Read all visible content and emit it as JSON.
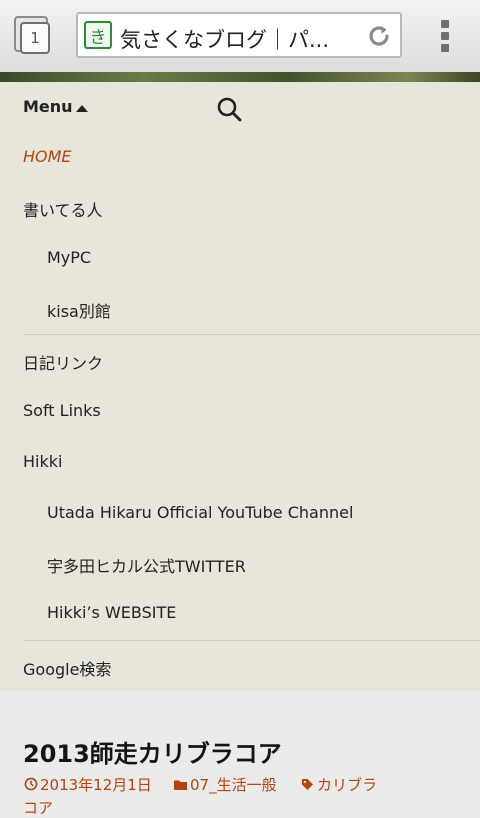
{
  "browser": {
    "tab_count": "1",
    "favicon_char": "き",
    "page_title": "気さくなブログ｜パ..."
  },
  "menu": {
    "label": "Menu",
    "items": [
      {
        "label": "HOME"
      },
      {
        "label": "書いてる人"
      },
      {
        "label": "MyPC"
      },
      {
        "label": "kisa別館"
      },
      {
        "label": "日記リンク"
      },
      {
        "label": "Soft Links"
      },
      {
        "label": "Hikki"
      },
      {
        "label": "Utada Hikaru Official YouTube Channel"
      },
      {
        "label": "宇多田ヒカル公式TWITTER"
      },
      {
        "label": "Hikki’s WEBSITE"
      },
      {
        "label": "Google検索"
      }
    ]
  },
  "post": {
    "title": "2013師走カリブラコア",
    "date": "2013年12月1日",
    "category": "07_生活一般",
    "tag_line1": "カリブラ",
    "tag_line2": "コア"
  },
  "colors": {
    "accent": "#b8420f",
    "menu_bg": "#e8e6da",
    "page_bg": "#ebebea"
  }
}
